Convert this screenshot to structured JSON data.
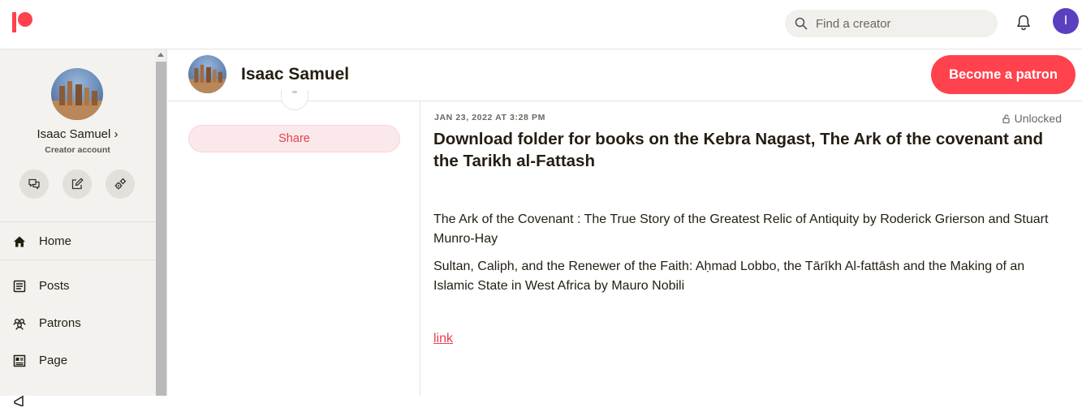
{
  "topbar": {
    "logo": "patreon-logo",
    "search_placeholder": "Find a creator",
    "avatar_initial": "I",
    "colors": {
      "brand": "#ff424d",
      "avatar": "#5a3fc0"
    }
  },
  "sidebar": {
    "name": "Isaac Samuel",
    "name_chevron": "›",
    "subtitle": "Creator account",
    "quick_actions": [
      "messages-icon",
      "edit-post-icon",
      "settings-icon"
    ],
    "items": [
      {
        "label": "Home",
        "icon": "home-icon"
      },
      {
        "label": "Posts",
        "icon": "posts-icon"
      },
      {
        "label": "Patrons",
        "icon": "patrons-icon"
      },
      {
        "label": "Page",
        "icon": "page-icon"
      }
    ]
  },
  "creator_header": {
    "name": "Isaac Samuel",
    "cta": "Become a patron"
  },
  "left_column": {
    "share_label": "Share"
  },
  "post": {
    "date": "JAN 23, 2022 AT 3:28 PM",
    "status": "Unlocked",
    "title": "Download folder for books on the Kebra Nagast, The Ark of the covenant and the Tarikh al-Fattash",
    "paragraphs": [
      "The Ark of the Covenant : The True Story of the Greatest Relic of Antiquity by Roderick Grierson and Stuart Munro-Hay",
      "Sultan, Caliph, and the Renewer of the Faith: Aḥmad Lobbo, the Tārīkh Al-fattāsh and the Making of an Islamic State in West Africa by Mauro Nobili"
    ],
    "link_text": "link"
  }
}
